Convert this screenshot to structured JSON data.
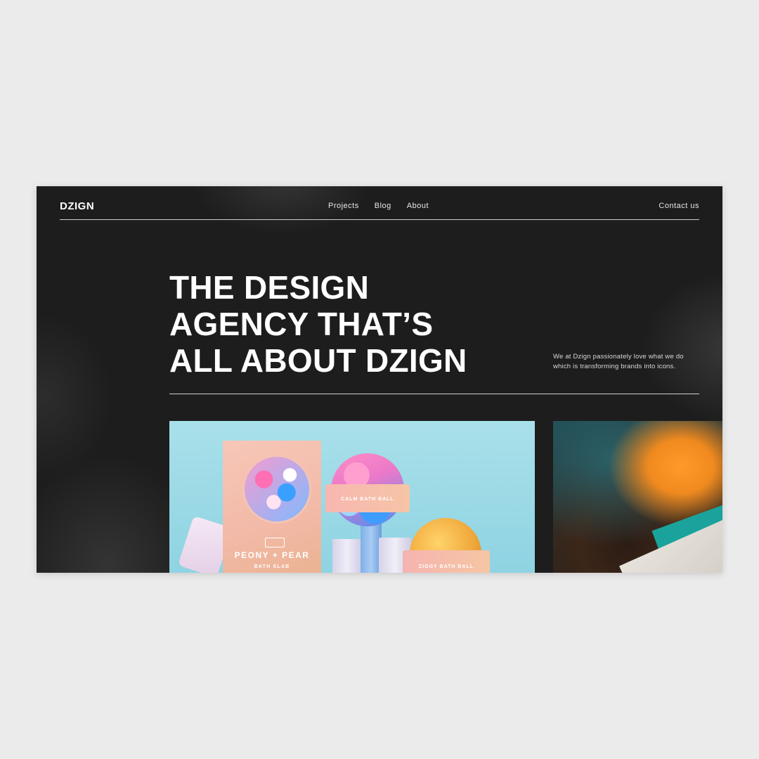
{
  "brand": {
    "logo": "DZIGN"
  },
  "nav": {
    "items": [
      {
        "label": "Projects"
      },
      {
        "label": "Blog"
      },
      {
        "label": "About"
      }
    ],
    "contact": "Contact us"
  },
  "hero": {
    "headline_lines": [
      "THE DESIGN",
      "AGENCY THAT’S",
      "ALL ABOUT DZIGN"
    ],
    "tagline": "We at Dzign passionately love what we do which is transforming brands into icons."
  },
  "projects": {
    "card1": {
      "box_title": "PEONY + PEAR",
      "box_subtitle": "BATH SLAB",
      "band1_label": "CALM BATH BALL",
      "band2_label": "ZIGGY BATH BALL"
    },
    "card2": {}
  },
  "colors": {
    "page_background": "#ebebeb",
    "site_background": "#1d1d1d",
    "text": "#ffffff",
    "card1_background": "#a9e0ea",
    "card2_accent": "#f08a1f"
  }
}
